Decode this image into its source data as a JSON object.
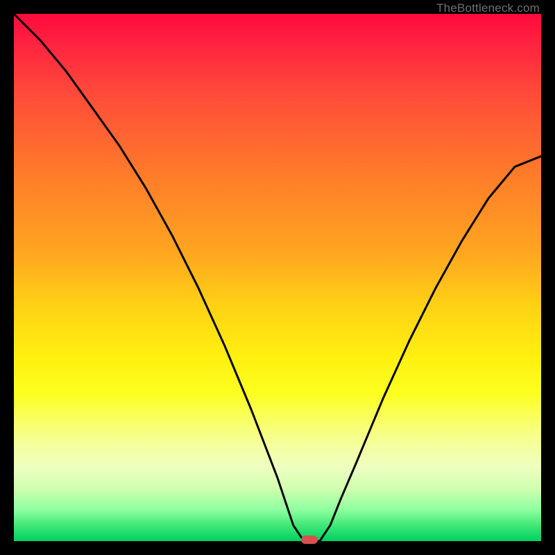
{
  "watermark": "TheBottleneck.com",
  "chart_data": {
    "type": "line",
    "title": "",
    "xlabel": "",
    "ylabel": "",
    "xlim": [
      0,
      100
    ],
    "ylim": [
      0,
      100
    ],
    "series": [
      {
        "name": "bottleneck_curve",
        "x": [
          0,
          5,
          10,
          15,
          20,
          25,
          30,
          35,
          40,
          45,
          50,
          53,
          55,
          57,
          58,
          60,
          62,
          65,
          70,
          75,
          80,
          85,
          90,
          95,
          100
        ],
        "y": [
          100,
          95,
          89,
          82,
          75,
          67,
          58,
          48,
          37,
          25,
          12,
          3,
          0,
          0,
          0,
          3,
          8,
          15,
          27,
          38,
          48,
          57,
          65,
          71,
          73
        ]
      }
    ],
    "marker": {
      "x": 56,
      "y": 0,
      "color": "#d85050"
    },
    "background": "rainbow_gradient_red_to_green"
  }
}
